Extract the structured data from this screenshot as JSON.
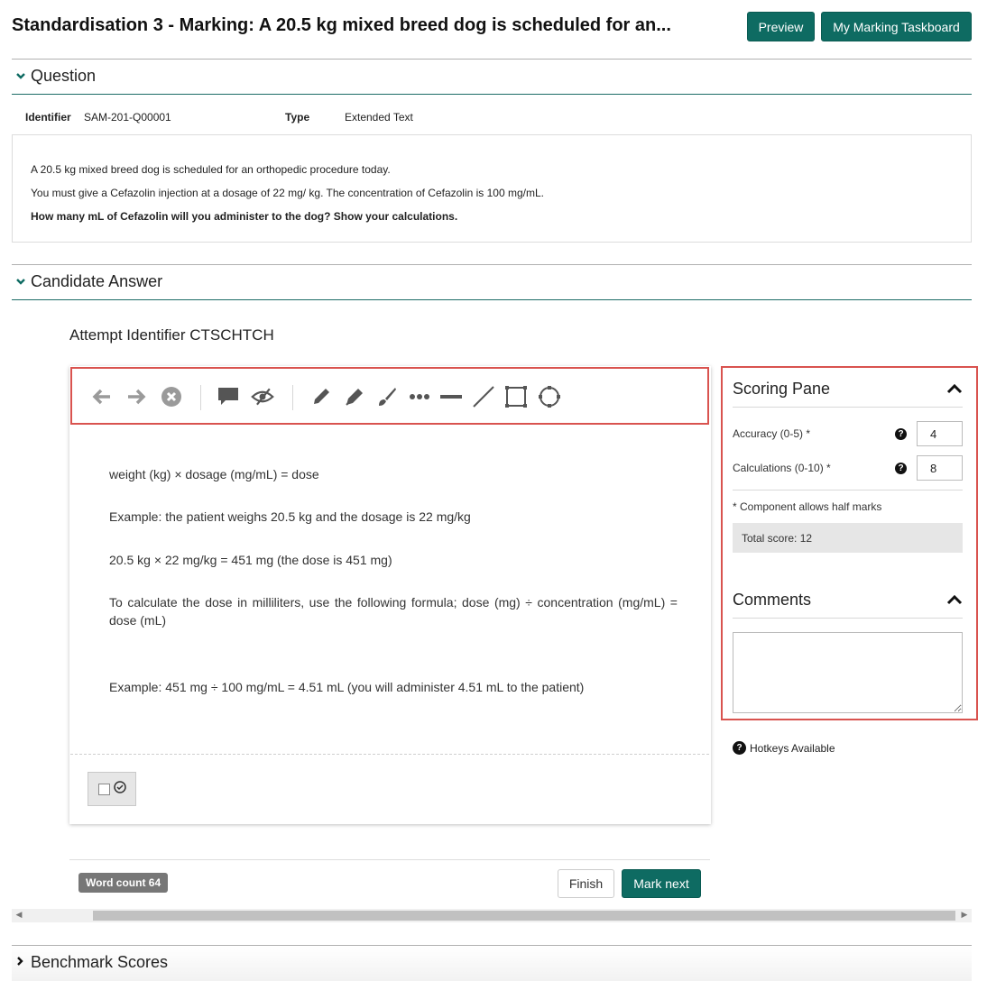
{
  "header": {
    "title": "Standardisation 3 - Marking: A 20.5 kg mixed breed dog is scheduled for an...",
    "preview_label": "Preview",
    "taskboard_label": "My Marking Taskboard"
  },
  "question": {
    "section_label": "Question",
    "identifier_label": "Identifier",
    "identifier_value": "SAM-201-Q00001",
    "type_label": "Type",
    "type_value": "Extended Text",
    "lines": [
      "A 20.5 kg mixed breed dog is scheduled for an orthopedic procedure today.",
      "You must give a Cefazolin injection at a dosage of 22 mg/ kg. The concentration of Cefazolin is 100 mg/mL.",
      "How many mL of Cefazolin will you administer to the dog? Show your calculations."
    ]
  },
  "candidate": {
    "section_label": "Candidate Answer",
    "attempt_label": "Attempt Identifier CTSCHTCH",
    "answer_lines": [
      "weight (kg) × dosage (mg/mL) = dose",
      "Example: the patient weighs 20.5 kg and the dosage is 22 mg/kg",
      "20.5 kg × 22 mg/kg = 451 mg (the dose is 451 mg)",
      "To calculate the dose in milliliters, use the following formula; dose (mg) ÷ concentration (mg/mL) = dose (mL)",
      "Example: 451 mg ÷ 100 mg/mL = 4.51 mL (you will administer 4.51 mL to the patient)"
    ],
    "toolbar_icons": [
      "arrow-left-icon",
      "arrow-right-icon",
      "clear-icon",
      "comment-icon",
      "hide-icon",
      "pencil-icon",
      "marker-icon",
      "brush-icon",
      "dots-icon",
      "line-thick-icon",
      "line-diagonal-icon",
      "rectangle-icon",
      "circle-icon"
    ]
  },
  "footer": {
    "word_count": "Word count 64",
    "finish_label": "Finish",
    "mark_next_label": "Mark next"
  },
  "scoring": {
    "title": "Scoring Pane",
    "items": [
      {
        "label": "Accuracy (0-5) *",
        "value": "4"
      },
      {
        "label": "Calculations (0-10) *",
        "value": "8"
      }
    ],
    "half_marks_note": "* Component allows half marks",
    "total": "Total score: 12"
  },
  "comments": {
    "title": "Comments",
    "value": ""
  },
  "hotkeys_label": "Hotkeys Available",
  "benchmark": {
    "section_label": "Benchmark Scores"
  },
  "colors": {
    "accent": "#0e6b62",
    "highlight_border": "#d9534f"
  }
}
